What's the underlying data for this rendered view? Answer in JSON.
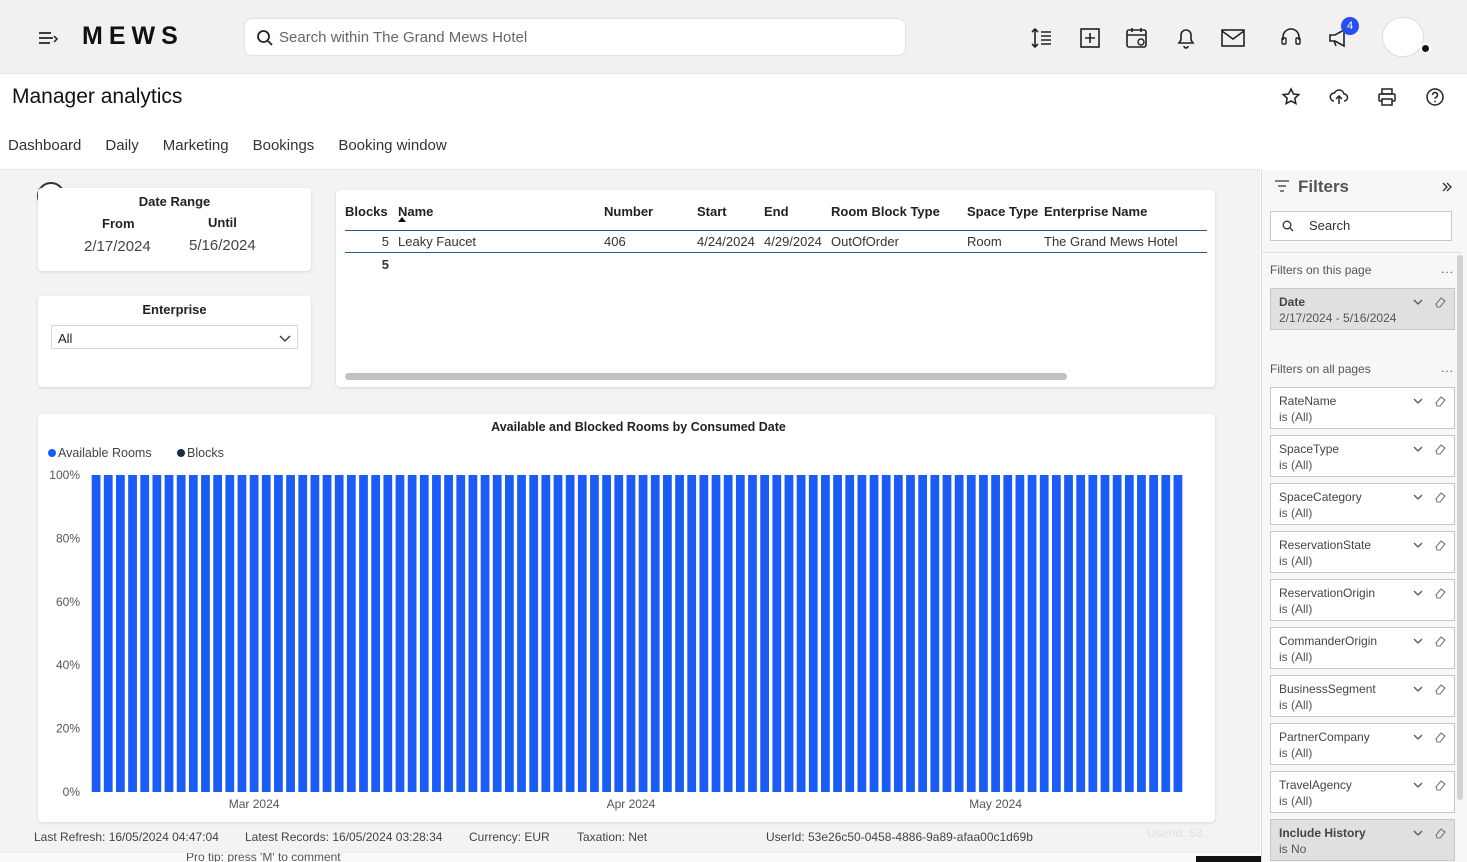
{
  "topbar": {
    "logo": "MEWS",
    "search_placeholder": "Search within The Grand Mews Hotel",
    "notification_count": "4"
  },
  "page": {
    "title": "Manager analytics",
    "tabs": [
      "Dashboard",
      "Daily",
      "Marketing",
      "Bookings",
      "Booking window"
    ]
  },
  "date_range": {
    "title": "Date Range",
    "from_label": "From",
    "until_label": "Until",
    "from_value": "2/17/2024",
    "until_value": "5/16/2024"
  },
  "enterprise": {
    "title": "Enterprise",
    "selected": "All"
  },
  "blocks_table": {
    "columns": [
      "Blocks",
      "Name",
      "Number",
      "Start",
      "End",
      "Room Block Type",
      "Space Type",
      "Enterprise Name"
    ],
    "rows": [
      [
        "5",
        "Leaky Faucet",
        "406",
        "4/24/2024",
        "4/29/2024",
        "OutOfOrder",
        "Room",
        "The Grand Mews Hotel"
      ]
    ],
    "total": "5"
  },
  "chart_data": {
    "type": "bar",
    "stacked": true,
    "title": "Available and Blocked Rooms by Consumed Date",
    "legend": [
      "Available Rooms",
      "Blocks"
    ],
    "legend_position": "top-left",
    "x_start": "2024-02-17",
    "x_end": "2024-05-16",
    "x_ticks": [
      "Mar 2024",
      "Apr 2024",
      "May 2024"
    ],
    "y_ticks": [
      "0%",
      "20%",
      "40%",
      "60%",
      "80%",
      "100%"
    ],
    "ylim": [
      0,
      100
    ],
    "series": [
      {
        "name": "Available Rooms",
        "color": "#1a5cf5",
        "value_each_day": 100
      },
      {
        "name": "Blocks",
        "color": "#1b2a4a",
        "value_each_day": 0
      }
    ],
    "grid": false
  },
  "footer": {
    "last_refresh": "Last Refresh: 16/05/2024 04:47:04",
    "latest_records": "Latest Records: 16/05/2024 03:28:34",
    "currency": "Currency: EUR",
    "taxation": "Taxation: Net",
    "user_id": "UserId: 53e26c50-0458-4886-9a89-afaa00c1d69b",
    "ghost_text": "UserId: 53...",
    "peek_text": "Pro tip: press 'M' to comment"
  },
  "filters_pane": {
    "title": "Filters",
    "search_placeholder": "Search",
    "this_page_label": "Filters on this page",
    "all_pages_label": "Filters on all pages",
    "more": "...",
    "this_page": [
      {
        "name": "Date",
        "value": "2/17/2024 - 5/16/2024"
      }
    ],
    "all_pages": [
      {
        "name": "RateName",
        "value": "is (All)"
      },
      {
        "name": "SpaceType",
        "value": "is (All)"
      },
      {
        "name": "SpaceCategory",
        "value": "is (All)"
      },
      {
        "name": "ReservationState",
        "value": "is (All)"
      },
      {
        "name": "ReservationOrigin",
        "value": "is (All)"
      },
      {
        "name": "CommanderOrigin",
        "value": "is (All)"
      },
      {
        "name": "BusinessSegment",
        "value": "is (All)"
      },
      {
        "name": "PartnerCompany",
        "value": "is (All)"
      },
      {
        "name": "TravelAgency",
        "value": "is (All)"
      },
      {
        "name": "Include History",
        "value": "is No"
      }
    ]
  },
  "colors": {
    "accent": "#1a5cf5",
    "blocks": "#1b2a4a",
    "badge": "#2a4df5"
  }
}
